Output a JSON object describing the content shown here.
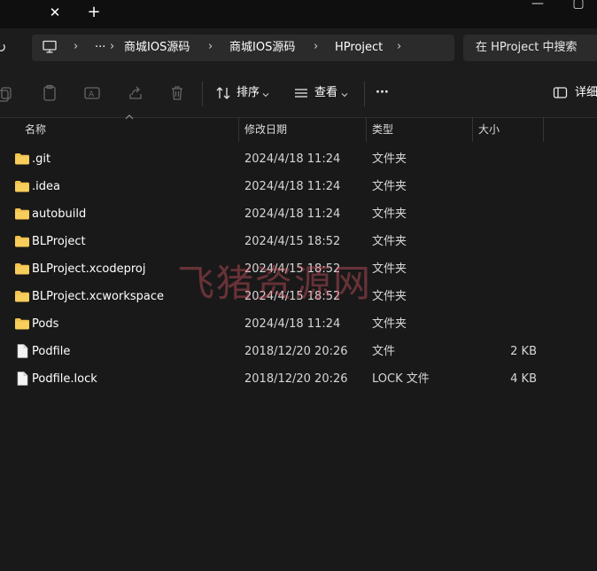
{
  "window": {
    "tab_close_glyph": "✕",
    "tab_new_glyph": "+",
    "minimize_glyph": "—",
    "maximize_glyph": "▢"
  },
  "address": {
    "refresh_glyph": "↻",
    "computer_glyph": "🖵",
    "ellipsis": "···",
    "separator": "›",
    "crumbs": [
      "商城IOS源码",
      "商城IOS源码",
      "HProject"
    ],
    "search_placeholder": "在 HProject 中搜索"
  },
  "toolbar": {
    "sort_label": "排序",
    "view_label": "查看",
    "more_label": "···",
    "details_label": "详细"
  },
  "columns": {
    "name": "名称",
    "modified": "修改日期",
    "type": "类型",
    "size": "大小"
  },
  "files": [
    {
      "name": ".git",
      "modified": "2024/4/18 11:24",
      "type": "文件夹",
      "size": "",
      "kind": "folder"
    },
    {
      "name": ".idea",
      "modified": "2024/4/18 11:24",
      "type": "文件夹",
      "size": "",
      "kind": "folder"
    },
    {
      "name": "autobuild",
      "modified": "2024/4/18 11:24",
      "type": "文件夹",
      "size": "",
      "kind": "folder"
    },
    {
      "name": "BLProject",
      "modified": "2024/4/15 18:52",
      "type": "文件夹",
      "size": "",
      "kind": "folder"
    },
    {
      "name": "BLProject.xcodeproj",
      "modified": "2024/4/15 18:52",
      "type": "文件夹",
      "size": "",
      "kind": "folder"
    },
    {
      "name": "BLProject.xcworkspace",
      "modified": "2024/4/15 18:52",
      "type": "文件夹",
      "size": "",
      "kind": "folder"
    },
    {
      "name": "Pods",
      "modified": "2024/4/18 11:24",
      "type": "文件夹",
      "size": "",
      "kind": "folder"
    },
    {
      "name": "Podfile",
      "modified": "2018/12/20 20:26",
      "type": "文件",
      "size": "2 KB",
      "kind": "file"
    },
    {
      "name": "Podfile.lock",
      "modified": "2018/12/20 20:26",
      "type": "LOCK 文件",
      "size": "4 KB",
      "kind": "file"
    }
  ],
  "watermark": "飞猪资源网",
  "colors": {
    "background": "#191919",
    "folder": "#f2c14e",
    "file": "#f4f4f4",
    "watermark": "#e85b6a"
  }
}
